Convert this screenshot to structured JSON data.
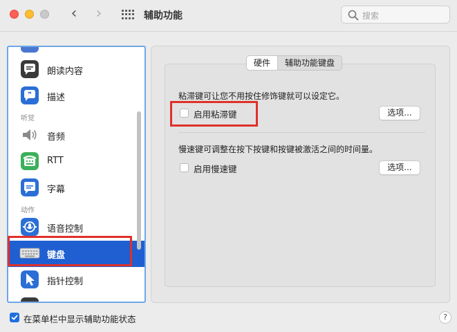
{
  "window": {
    "title": "辅助功能",
    "search_placeholder": "搜索"
  },
  "sidebar": {
    "sections": {
      "hearing": "听觉",
      "motor": "动作"
    },
    "items": [
      {
        "label": "朗读内容",
        "icon": "speech-bubble-icon",
        "color": "#3a3a3a"
      },
      {
        "label": "描述",
        "icon": "quote-bubble-icon",
        "color": "#2b6fd6"
      },
      {
        "label": "音频",
        "icon": "speaker-icon",
        "color": "#888888"
      },
      {
        "label": "RTT",
        "icon": "rtt-phone-icon",
        "color": "#3bb05a"
      },
      {
        "label": "字幕",
        "icon": "caption-icon",
        "color": "#2b6fd6"
      },
      {
        "label": "语音控制",
        "icon": "voice-control-icon",
        "color": "#2b6fd6"
      },
      {
        "label": "键盘",
        "icon": "keyboard-icon",
        "color": "#d9d9d9",
        "selected": true
      },
      {
        "label": "指针控制",
        "icon": "pointer-icon",
        "color": "#2b6fd6"
      }
    ]
  },
  "main": {
    "tabs": [
      {
        "label": "硬件",
        "active": true
      },
      {
        "label": "辅助功能键盘",
        "active": false
      }
    ],
    "sticky_keys": {
      "description": "粘滞键可让您不用按住修饰键就可以设定它。",
      "checkbox_label": "启用粘滞键",
      "checked": false,
      "options_label": "选项..."
    },
    "slow_keys": {
      "description": "慢速键可调整在按下按键和按键被激活之间的时间量。",
      "checkbox_label": "启用慢速键",
      "checked": false,
      "options_label": "选项..."
    }
  },
  "bottom": {
    "menu_bar_label": "在菜单栏中显示辅助功能状态",
    "checked": true,
    "help_label": "?"
  },
  "colors": {
    "accent": "#1f5fd1",
    "highlight_box": "#e0302a"
  }
}
